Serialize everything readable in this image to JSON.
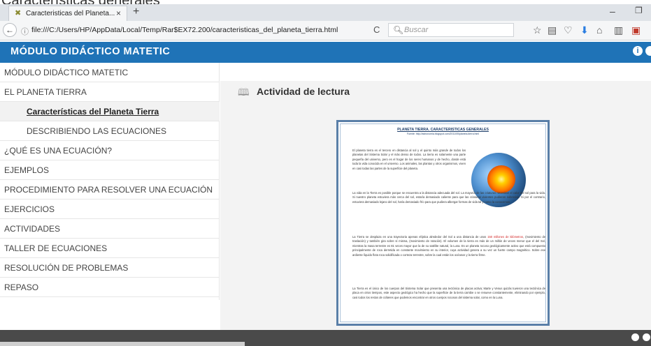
{
  "page": {
    "clipped_heading": "Características generales"
  },
  "browser": {
    "tab_title": "Caracteristicas del Planeta...",
    "url": "file:///C:/Users/HP/AppData/Local/Temp/Rar$EX72.200/caracteristicas_del_planeta_tierra.html",
    "search_placeholder": "Buscar"
  },
  "app": {
    "title": "MÓDULO DIDÁCTICO MATETIC",
    "info_label": "i"
  },
  "sidebar": {
    "items": [
      {
        "label": "MÓDULO DIDÁCTICO MATETIC",
        "level": 0,
        "active": false
      },
      {
        "label": "EL PLANETA TIERRA",
        "level": 0,
        "active": false
      },
      {
        "label": "Características del Planeta Tierra",
        "level": 1,
        "active": true
      },
      {
        "label": "DESCRIBIENDO LAS ECUACIONES",
        "level": 1,
        "active": false
      },
      {
        "label": "¿QUÉ ES UNA ECUACIÓN?",
        "level": 0,
        "active": false
      },
      {
        "label": "EJEMPLOS",
        "level": 0,
        "active": false
      },
      {
        "label": "PROCEDIMIENTO PARA RESOLVER UNA ECUACIÓN",
        "level": 0,
        "active": false
      },
      {
        "label": "EJERCICIOS",
        "level": 0,
        "active": false
      },
      {
        "label": "ACTIVIDADES",
        "level": 0,
        "active": false
      },
      {
        "label": "TALLER DE ECUACIONES",
        "level": 0,
        "active": false
      },
      {
        "label": "RESOLUCIÓN DE PROBLEMAS",
        "level": 0,
        "active": false
      },
      {
        "label": "REPASO",
        "level": 0,
        "active": false
      }
    ]
  },
  "content": {
    "title": "Actividad de lectura",
    "document": {
      "title": "PLANETA TIERRA. CARACTERISTICAS GENERALES",
      "source": "Fuente: http://astronomia.blogspot.com/2011/05/planeta-tierra.html",
      "p1": "El planeta tierra es el tercero en distancia al sol y el quinto más grande de todos los planetas del Sistema Solar y el más denso de todos. La tierra es solamente una parte pequeña del universo, pero es el hogar de los seres humanos y de hecho, donde está toda la vida conocida en el universo. Los animales, las plantas y otros organismos, viven en casi todas las partes de la superficie del planeta.",
      "p2": "La vida en la Tierra es posible porque se encuentra a la distancia adecuada del sol. La mayoría de las criaturas necesitan el calor del sol para la vida. Si nuestro planeta estuviera más cerca del sol, estaría demasiado caliente para que las criaturas vivientes pudieran sobrevivir. Si por el contrario, estuviera demasiado lejano del sol, haría demasiado frío para que pudiera albergar formas de vida tal y como la conocemos.",
      "p3a": "La Tierra se desplaza en una trayectoria apenas elíptica alrededor del Sol a una distancia de unos",
      "p3red": "150 millones de kilómetros",
      "p3b": ", (movimiento de traslación) y también gira sobre sí misma, (movimiento de rotación). El volumen de la tierra es más de un millón de veces menor que el del Sol, mientras la masa terrestre es 81 veces mayor que la de su satélite natural, la Luna. Es un planeta rocoso geológicamente activo que está compuesto principalmente de roca derretida en constante movimiento en su interior, cuya actividad genera a su vez un fuerte campo magnético. Sobre ese ardiente líquido flota roca solidificada o corteza terrestre, sobre la cual están los océanos y la tierra firme.",
      "p4": "La Tierra es el único de los cuerpos del Sistema Solar que presenta una tectónica de placas activa; Marte y Venus quizás tuvieron una tectónica de placa en otros tiempos, este aspecto geológico ha hecho que la superficie de la tierra cambie o se renueve constantemente, eliminando por ejemplo, casi todos los restos de cráteres que podemos encontrar en otros cuerpos rocosos del sistema solar, como en la Luna."
    }
  },
  "colors": {
    "header_blue": "#1f73b7",
    "bottom_bar": "#4a4a4a",
    "highlight_red": "#d02020"
  }
}
